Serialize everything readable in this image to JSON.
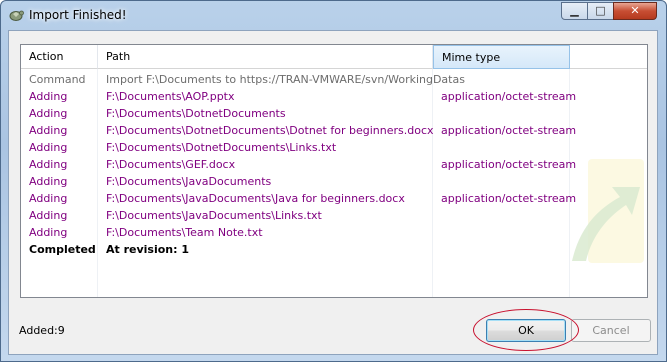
{
  "window": {
    "title": "Import Finished!"
  },
  "controls": {
    "minimize": "▁",
    "maximize": "□",
    "close": "✕"
  },
  "columns": {
    "action": "Action",
    "path": "Path",
    "mime": "Mime type"
  },
  "rows": [
    {
      "action": "Command",
      "path": "Import F:\\Documents to https://TRAN-VMWARE/svn/WorkingDatas",
      "mime": ""
    },
    {
      "action": "Adding",
      "path": "F:\\Documents\\AOP.pptx",
      "mime": "application/octet-stream"
    },
    {
      "action": "Adding",
      "path": "F:\\Documents\\DotnetDocuments",
      "mime": ""
    },
    {
      "action": "Adding",
      "path": "F:\\Documents\\DotnetDocuments\\Dotnet for beginners.docx",
      "mime": "application/octet-stream"
    },
    {
      "action": "Adding",
      "path": "F:\\Documents\\DotnetDocuments\\Links.txt",
      "mime": ""
    },
    {
      "action": "Adding",
      "path": "F:\\Documents\\GEF.docx",
      "mime": "application/octet-stream"
    },
    {
      "action": "Adding",
      "path": "F:\\Documents\\JavaDocuments",
      "mime": ""
    },
    {
      "action": "Adding",
      "path": "F:\\Documents\\JavaDocuments\\Java for beginners.docx",
      "mime": "application/octet-stream"
    },
    {
      "action": "Adding",
      "path": "F:\\Documents\\JavaDocuments\\Links.txt",
      "mime": ""
    },
    {
      "action": "Adding",
      "path": "F:\\Documents\\Team Note.txt",
      "mime": ""
    },
    {
      "action": "Completed",
      "path": "At revision: 1",
      "mime": ""
    }
  ],
  "footer": {
    "added": "Added:9"
  },
  "buttons": {
    "ok": "OK",
    "cancel": "Cancel"
  },
  "colors": {
    "adding": "#800080",
    "command": "#6d6d6d",
    "completed": "#000000",
    "highlight": "#c8102e"
  }
}
